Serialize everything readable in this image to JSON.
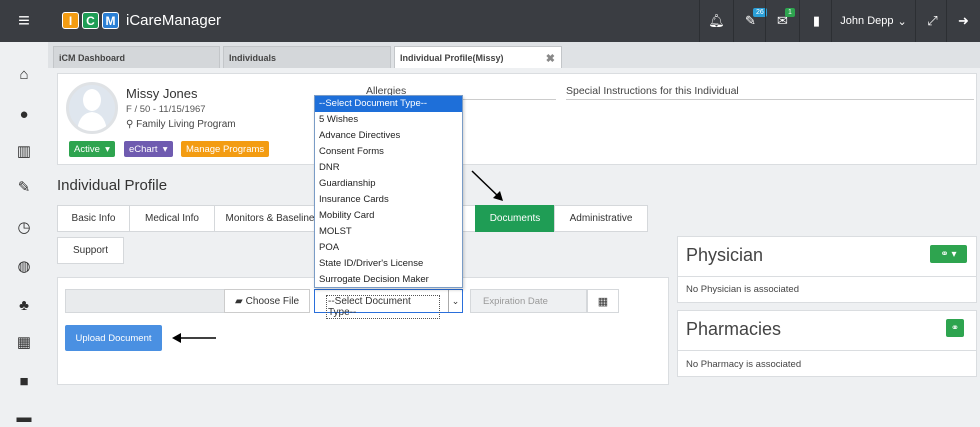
{
  "app": {
    "name": "iCareManager",
    "logo_letters": [
      "I",
      "C",
      "M"
    ]
  },
  "topbar": {
    "badges": {
      "edit": "26",
      "mail": "1"
    },
    "user": "John Depp"
  },
  "tabs": [
    {
      "label": "iCM Dashboard"
    },
    {
      "label": "Individuals"
    },
    {
      "label": "Individual Profile(Missy)",
      "close": "✖"
    }
  ],
  "profile": {
    "name": "Missy Jones",
    "info": "F / 50 - 11/15/1967",
    "program": "Family Living Program",
    "buttons": {
      "status": "Active",
      "echart": "eChart",
      "manage": "Manage Programs"
    },
    "allergies_label": "Allergies",
    "special_label": "Special Instructions for this Individual"
  },
  "section_title": "Individual Profile",
  "profile_tabs": [
    "Basic Info",
    "Medical Info",
    "Monitors & Baseline",
    "Documents",
    "Administrative",
    "Support"
  ],
  "documents": {
    "choose_file": "Choose File",
    "select_value": "--Select Document Type--",
    "expiration_placeholder": "Expiration Date",
    "upload_label": "Upload Document",
    "options": [
      "--Select Document Type--",
      "5 Wishes",
      "Advance Directives",
      "Consent Forms",
      "DNR",
      "Guardianship",
      "Insurance Cards",
      "Mobility Card",
      "MOLST",
      "POA",
      "State ID/Driver's License",
      "Surrogate Decision Maker"
    ]
  },
  "physician": {
    "title": "Physician",
    "empty": "No Physician is associated"
  },
  "pharmacies": {
    "title": "Pharmacies",
    "empty": "No Pharmacy is associated"
  },
  "colors": {
    "topbar": "#3a3d42",
    "green": "#1f9d55",
    "purple": "#6f5bb0",
    "orange": "#f39c12",
    "blue": "#4a90e2"
  }
}
